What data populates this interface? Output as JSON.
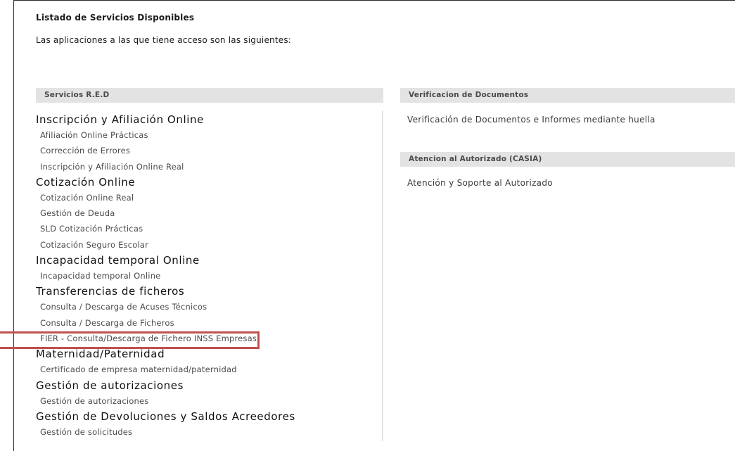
{
  "page": {
    "title": "Listado de Servicios Disponibles",
    "intro": "Las aplicaciones a las que tiene acceso son las siguientes:"
  },
  "left_panel": {
    "header": "Servicios R.E.D",
    "groups": [
      {
        "title": "Inscripción y Afiliación Online",
        "links": [
          "Afiliación Online Prácticas",
          "Corrección de Errores",
          "Inscripción y Afiliación Online Real"
        ]
      },
      {
        "title": "Cotización Online",
        "links": [
          "Cotización Online Real",
          "Gestión de Deuda",
          "SLD Cotización Prácticas",
          "Cotización Seguro Escolar"
        ]
      },
      {
        "title": "Incapacidad temporal Online",
        "links": [
          "Incapacidad temporal Online"
        ]
      },
      {
        "title": "Transferencias de ficheros",
        "links": [
          "Consulta / Descarga de Acuses Técnicos",
          "Consulta / Descarga de Ficheros",
          "FIER - Consulta/Descarga de Fichero INSS Empresas"
        ]
      },
      {
        "title": "Maternidad/Paternidad",
        "links": [
          "Certificado de empresa maternidad/paternidad"
        ]
      },
      {
        "title": "Gestión de autorizaciones",
        "links": [
          "Gestión de autorizaciones"
        ]
      },
      {
        "title": "Gestión de Devoluciones y Saldos Acreedores",
        "links": [
          "Gestión de solicitudes"
        ]
      }
    ]
  },
  "right_panel": {
    "verificacion": {
      "header": "Verificacion de Documentos",
      "link": "Verificación de Documentos e Informes mediante huella"
    },
    "casia": {
      "header": "Atencion al Autorizado (CASIA)",
      "link": "Atención y Soporte al Autorizado"
    }
  },
  "annotation": {
    "color": "#c0504d"
  }
}
